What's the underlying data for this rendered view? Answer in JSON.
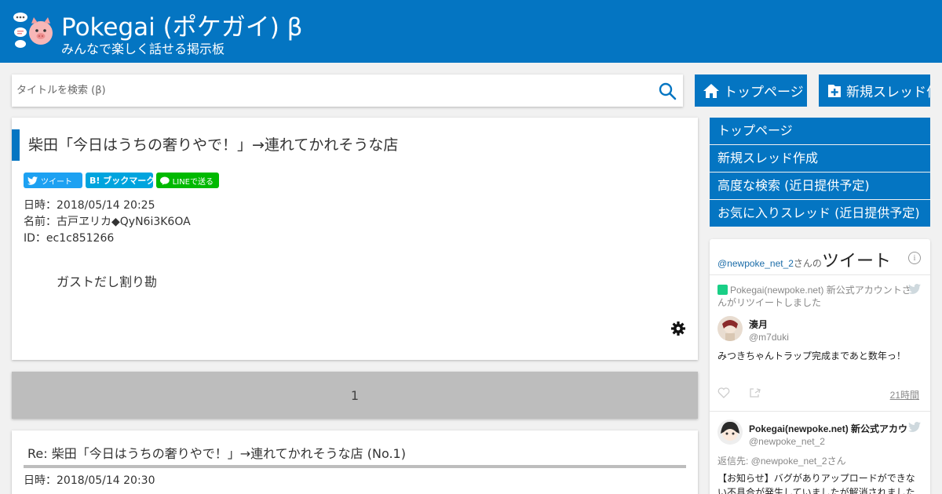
{
  "header": {
    "title": "Pokegai (ポケガイ) β",
    "subtitle": "みんなで楽しく話せる掲示板"
  },
  "search": {
    "placeholder": "タイトルを検索 (β)"
  },
  "nav": {
    "top_label": "トップページ",
    "new_label": "新規スレッド作"
  },
  "post": {
    "title": "柴田「今日はうちの奢りやで！」→連れてかれそうな店",
    "share": {
      "tweet": "ツイート",
      "bookmark": "B! ブックマーク",
      "line": "LINEで送る"
    },
    "date": "日時：2018/05/14 20:25",
    "name": "名前：古戸ヱリカ◆QyN6i3K6OA",
    "id": "ID：ec1c851266",
    "body": "ガストだし割り勘"
  },
  "pager": {
    "current": "1"
  },
  "reply": {
    "title": "Re: 柴田「今日はうちの奢りやで！」→連れてかれそうな店 (No.1)",
    "date": "日時：2018/05/14 20:30"
  },
  "sidebar": {
    "items": [
      {
        "label": "トップページ"
      },
      {
        "label": "新規スレッド作成"
      },
      {
        "label": "高度な検索 (近日提供予定)"
      },
      {
        "label": "お気に入りスレッド (近日提供予定)"
      }
    ]
  },
  "twitter": {
    "handle": "@newpoke_net_2",
    "sanno": "さんの",
    "heading": "ツイート",
    "retweet_note": "Pokegai(newpoke.net) 新公式アカウントさんがリツイートしました",
    "tweet1": {
      "name": "湊月",
      "handle": "@m7duki",
      "text": "みつきちゃんトラップ完成まであと数年っ！",
      "time": "21時間"
    },
    "tweet2": {
      "name": "Pokegai(newpoke.net) 新公式アカウ",
      "handle": "@newpoke_net_2",
      "reply_to": "返信先: @newpoke_net_2さん",
      "text": "【お知らせ】バグがありアップロードができない不具合が発生していましたが解消されました"
    }
  },
  "colors": {
    "brand": "#0475c2",
    "pager": "#bdbdbd",
    "twitter": "#1da1f2",
    "hatena": "#00a4de",
    "line": "#00b900"
  }
}
